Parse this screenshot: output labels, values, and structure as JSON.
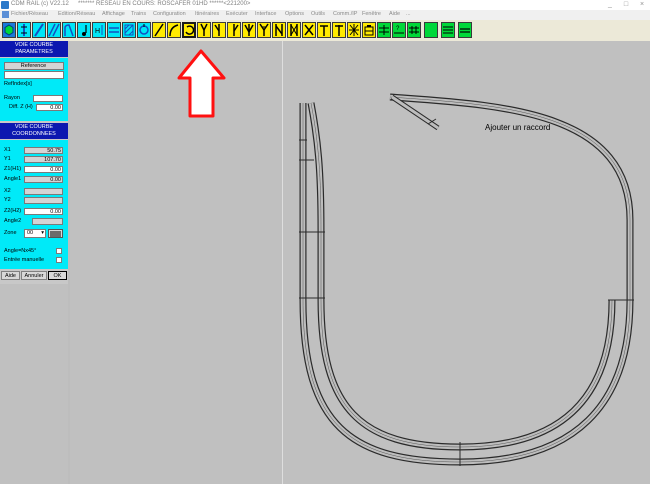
{
  "titlebar": {
    "app_title": "CDM RAIL (c) V22.12",
    "network_title": "******* RESEAU EN COURS: ROSCAFER 01HD ******<221200>",
    "minimize": "_",
    "maximize": "□",
    "close": "×"
  },
  "menu": [
    "Fichier/Réseau",
    "Edition/Réseau",
    "Affichage",
    "Trains",
    "Configuration",
    "Itinéraires",
    "Exécuter",
    "Interface",
    "Options",
    "Outils",
    "Comm./IP",
    "Fenêtre",
    "Aide",
    "..."
  ],
  "panel": {
    "header1_line1": "VOIE COURBE",
    "header1_line2": "PARAMETRES",
    "reference_label": "Reference",
    "refindex_label": "RefIndex[s]",
    "rayon_label": "Rayon",
    "diffz_label": "Diff. Z (H)",
    "diffz_value": "0.00",
    "header2_line1": "VOIE COURBE",
    "header2_line2": "COORDONNEES",
    "x1_label": "X1",
    "x1_value": "50.75",
    "y1_label": "Y1",
    "y1_value": "107.70",
    "z1_label": "Z1(H1)",
    "z1_value": "0.00",
    "angle1_label": "Angle1",
    "angle1_value": "0.00",
    "x2_label": "X2",
    "y2_label": "Y2",
    "z2_label": "Z2(H2)",
    "z2_value": "0.00",
    "angle2_label": "Angle2",
    "zone_label": "Zone",
    "zone_value": "00",
    "angle_nx45_label": "Angle=Nx45°",
    "entree_label": "Entrée manuelle",
    "aide_button": "Aide",
    "annuler_button": "Annuler",
    "ok_button": "OK"
  },
  "canvas": {
    "annotation": "Ajouter un raccord"
  },
  "colors": {
    "toolbar_cyan": "#00e6f6",
    "toolbar_yellow": "#ffea00",
    "toolbar_green": "#00d838",
    "panel_header": "#0c17b0",
    "panel_cyan": "#00eaf8",
    "arrow_red": "#ff1010",
    "canvas_bg": "#c0c0c0"
  },
  "toolbar_icons": [
    "hexagon-icon",
    "track-straight-icon",
    "track-diagonal-icon",
    "track-double-icon",
    "track-curve-end-icon",
    "track-music-icon",
    "track-h-icon",
    "track-parallel-icon",
    "track-hatch-icon",
    "track-cycle-icon",
    "track-slash-icon",
    "track-curve-icon",
    "track-circle-curve-icon",
    "turnout-y-icon",
    "turnout-left-icon",
    "turnout-right-icon",
    "turnout-wye-icon",
    "turnout-double-wye-icon",
    "crossing-double-icon",
    "crossing-x-icon",
    "crossing-slip-icon",
    "turntable-icon",
    "star-crossing-icon",
    "signal-icon",
    "building-icon",
    "transfer-icon",
    "green-block-icon",
    "green-lines-icon",
    "green-track-icon"
  ]
}
